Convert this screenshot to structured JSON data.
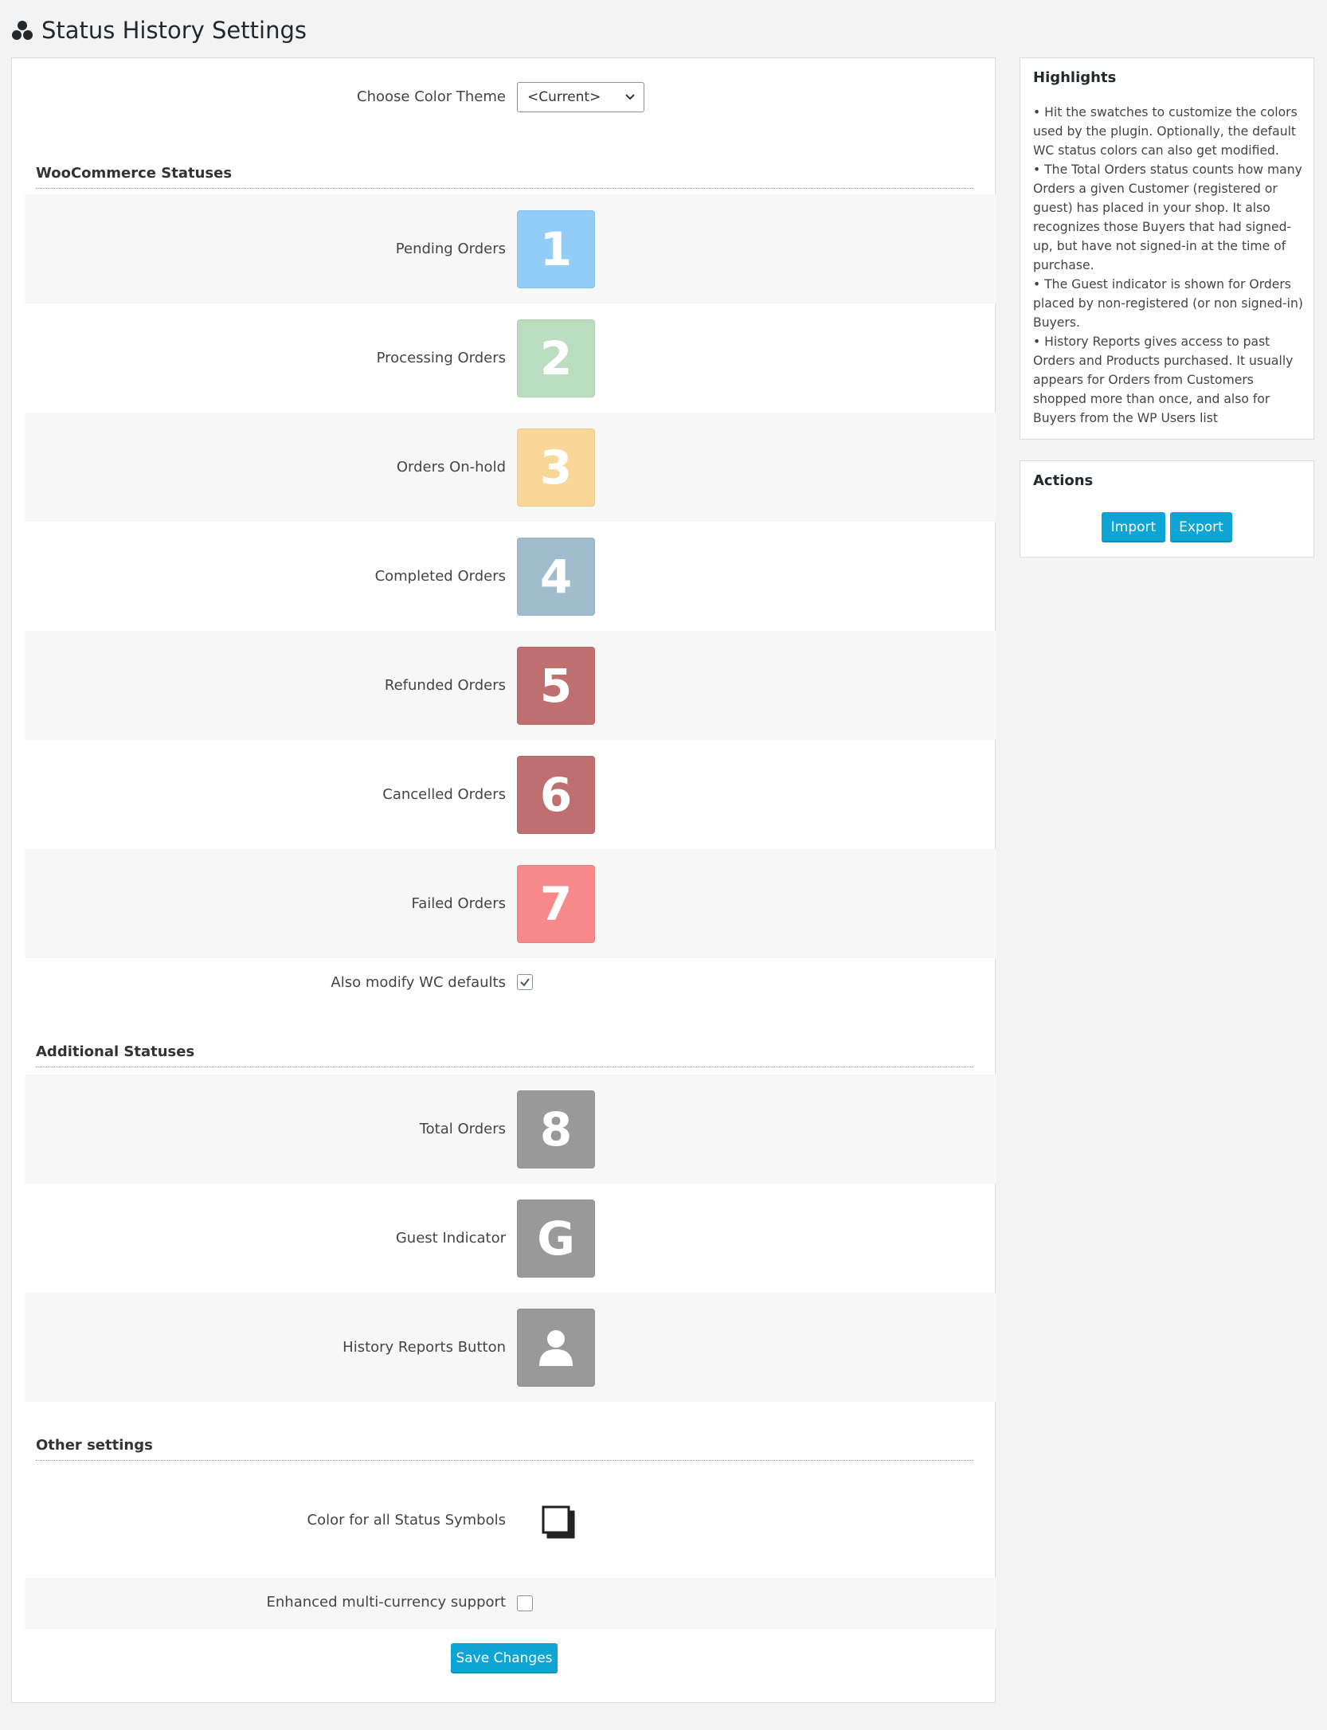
{
  "page": {
    "title": "Status History Settings"
  },
  "theme": {
    "label": "Choose Color Theme",
    "selected": "<Current>"
  },
  "woo_section": {
    "heading": "WooCommerce Statuses",
    "items": [
      {
        "label": "Pending Orders",
        "symbol": "1",
        "color": "#91cdf7"
      },
      {
        "label": "Processing Orders",
        "symbol": "2",
        "color": "#bbddbf"
      },
      {
        "label": "Orders On-hold",
        "symbol": "3",
        "color": "#f9d797"
      },
      {
        "label": "Completed Orders",
        "symbol": "4",
        "color": "#a1bccc"
      },
      {
        "label": "Refunded Orders",
        "symbol": "5",
        "color": "#bf6f6f"
      },
      {
        "label": "Cancelled Orders",
        "symbol": "6",
        "color": "#bf6f6f"
      },
      {
        "label": "Failed Orders",
        "symbol": "7",
        "color": "#f7898b"
      }
    ],
    "modify_defaults": {
      "label": "Also modify WC defaults",
      "checked": true
    }
  },
  "additional_section": {
    "heading": "Additional Statuses",
    "items": [
      {
        "label": "Total Orders",
        "symbol": "8",
        "color": "#999999"
      },
      {
        "label": "Guest Indicator",
        "symbol": "G",
        "color": "#999999"
      },
      {
        "label": "History Reports Button",
        "icon": "user-icon",
        "color": "#999999"
      }
    ]
  },
  "other_section": {
    "heading": "Other settings",
    "symbol_color": {
      "label": "Color for all Status Symbols",
      "icon": "color-squares-icon"
    },
    "multicurrency": {
      "label": "Enhanced multi-currency support",
      "checked": false
    }
  },
  "save_button": "Save Changes",
  "highlights": {
    "title": "Highlights",
    "items": [
      "• Hit the swatches to customize the colors",
      "used by the plugin. Optionally, the default",
      "WC status colors can also get modified.",
      "• The Total Orders status counts how many",
      "Orders a given Customer (registered or",
      "guest) has placed in your shop. It also",
      "recognizes those Buyers that had signed-",
      "up, but have not signed-in at the time of",
      "purchase.",
      "• The Guest indicator is shown for Orders",
      "placed by non-registered (or non signed-in)",
      "Buyers.",
      "• History Reports gives access to past",
      "Orders and Products purchased. It usually",
      "appears for Orders from Customers",
      "shopped more than once, and also for",
      "Buyers from the WP Users list"
    ]
  },
  "actions": {
    "title": "Actions",
    "import_label": "Import",
    "export_label": "Export"
  },
  "colors": {
    "accent": "#0ea5d4",
    "band": "#f7f7f7"
  }
}
